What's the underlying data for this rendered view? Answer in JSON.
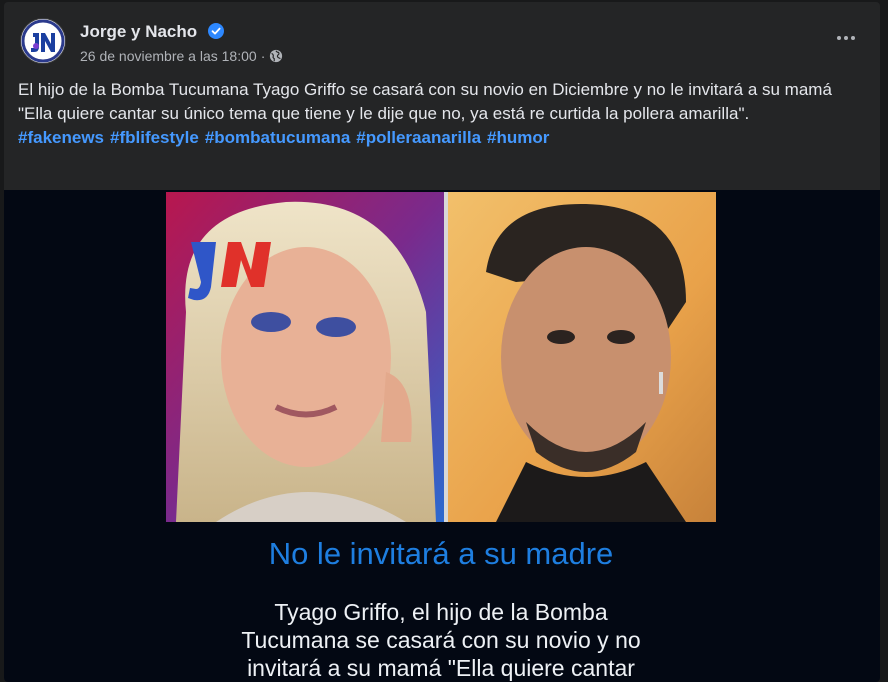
{
  "post": {
    "page_name": "Jorge y Nacho",
    "timestamp": "26 de noviembre a las 18:00",
    "separator": "·",
    "text": "El hijo de la Bomba Tucumana Tyago Griffo se casará con su novio en Diciembre y no le invitará a su mamá \"Ella quiere cantar su único tema que tiene y le dije que no, ya está re curtida la pollera amarilla\".",
    "hashtags": [
      "#fakenews",
      "#fblifestyle",
      "#bombatucumana",
      "#polleraanarilla",
      "#humor"
    ]
  },
  "icons": {
    "avatar": "jn-logo",
    "verified": "verified-badge-icon",
    "privacy": "globe-icon",
    "menu": "more-options-icon"
  },
  "media": {
    "logo_text": "JN",
    "headline": "No le invitará a su madre",
    "body_lines": [
      "Tyago Griffo, el hijo de la Bomba",
      "Tucumana se casará con su novio y no",
      "invitará a su mamá \"Ella quiere cantar"
    ]
  },
  "colors": {
    "background": "#242526",
    "link": "#4599ff",
    "headline": "#1e7ee0",
    "verified": "#2d88ff"
  }
}
